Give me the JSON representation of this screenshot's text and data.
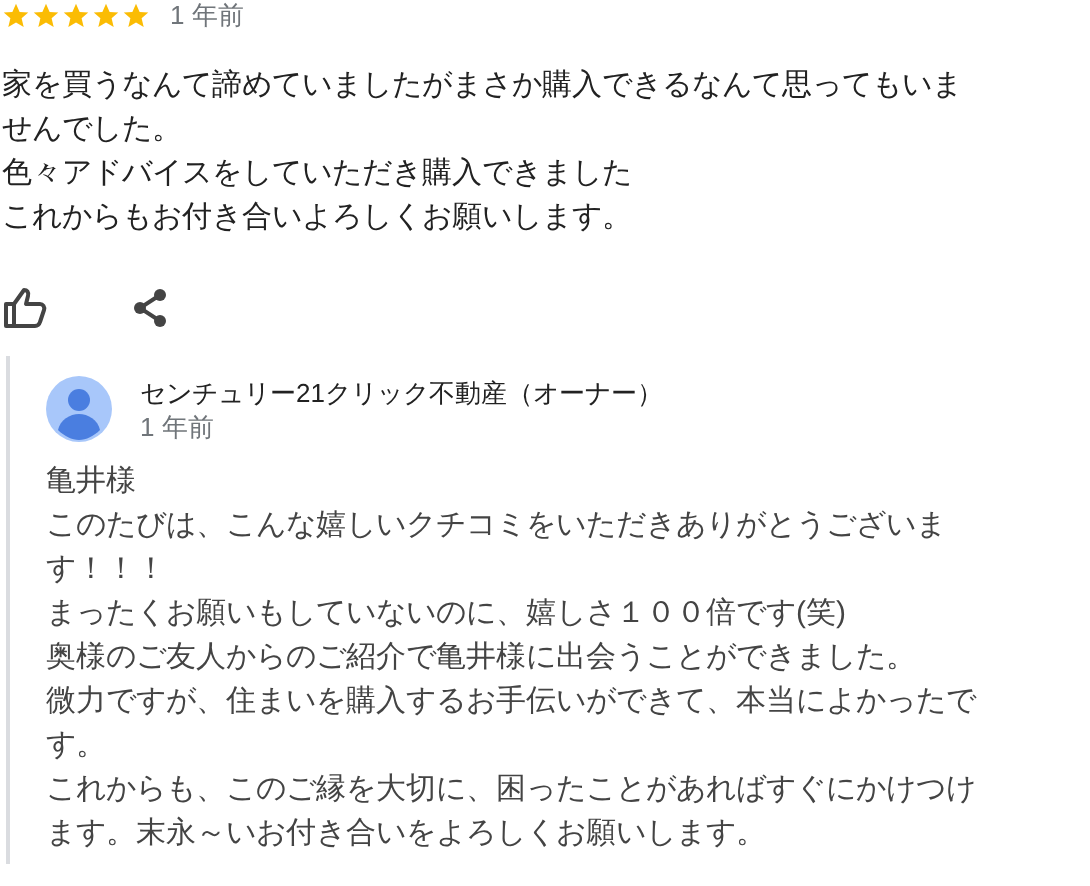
{
  "review": {
    "stars": 5,
    "time": "1 年前",
    "paragraphs": [
      "家を買うなんて諦めていましたがまさか購入できるなんて思ってもいませんでした。",
      "色々アドバイスをしていただき購入できました",
      "これからもお付き合いよろしくお願いします。"
    ]
  },
  "owner_reply": {
    "name": "センチュリー21クリック不動産（オーナー）",
    "time": "1 年前",
    "paragraphs": [
      "亀井様",
      "このたびは、こんな嬉しいクチコミをいただきありがとうございます！！！",
      "まったくお願いもしていないのに、嬉しさ１００倍です(笑)",
      "奥様のご友人からのご紹介で亀井様に出会うことができました。",
      "微力ですが、住まいを購入するお手伝いができて、本当によかったです。",
      "これからも、このご縁を大切に、困ったことがあればすぐにかけつけます。末永～いお付き合いをよろしくお願いします。"
    ]
  }
}
